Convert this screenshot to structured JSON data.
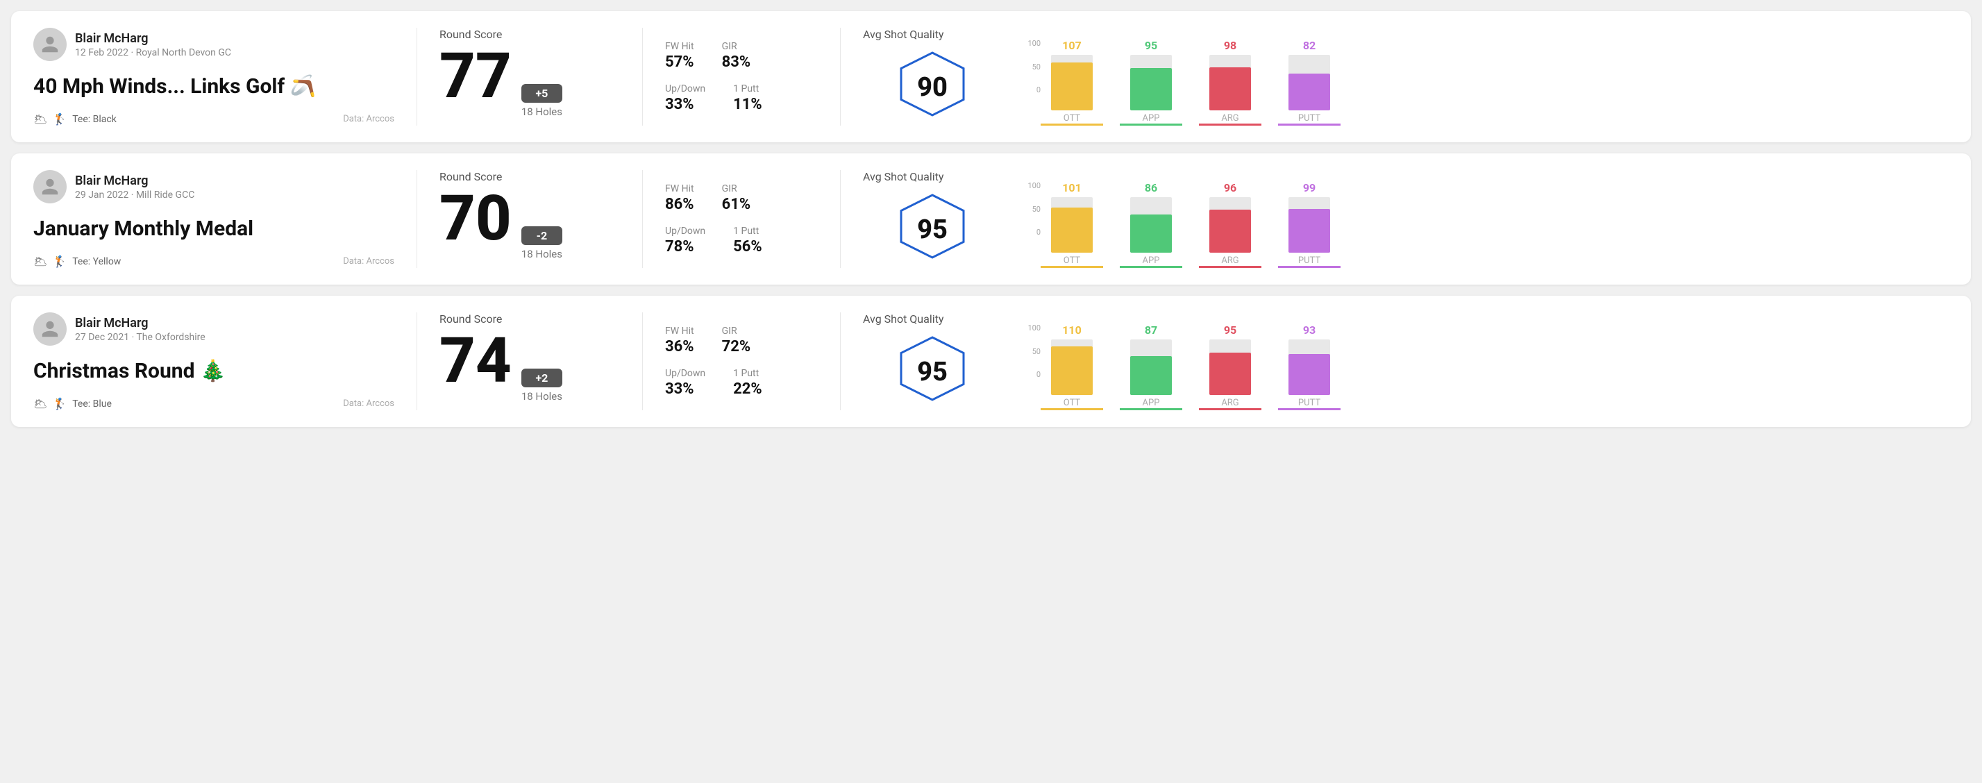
{
  "rounds": [
    {
      "id": "round-1",
      "user": {
        "name": "Blair McHarg",
        "date": "12 Feb 2022 · Royal North Devon GC"
      },
      "title": "40 Mph Winds... Links Golf 🪃",
      "tee": "Black",
      "dataSource": "Data: Arccos",
      "score": {
        "label": "Round Score",
        "value": "77",
        "modifier": "+5",
        "modifier_sign": "positive",
        "holes": "18 Holes"
      },
      "stats": {
        "fw_hit_label": "FW Hit",
        "fw_hit_value": "57%",
        "gir_label": "GIR",
        "gir_value": "83%",
        "updown_label": "Up/Down",
        "updown_value": "33%",
        "oneputt_label": "1 Putt",
        "oneputt_value": "11%"
      },
      "quality": {
        "label": "Avg Shot Quality",
        "value": "90"
      },
      "chart": {
        "bars": [
          {
            "label": "OTT",
            "value": 107,
            "max": 125,
            "color_class": "bar-ott",
            "text_class": "color-ott",
            "underline_class": "underline-ott"
          },
          {
            "label": "APP",
            "value": 95,
            "max": 125,
            "color_class": "bar-app",
            "text_class": "color-app",
            "underline_class": "underline-app"
          },
          {
            "label": "ARG",
            "value": 98,
            "max": 125,
            "color_class": "bar-arg",
            "text_class": "color-arg",
            "underline_class": "underline-arg"
          },
          {
            "label": "PUTT",
            "value": 82,
            "max": 125,
            "color_class": "bar-putt",
            "text_class": "color-putt",
            "underline_class": "underline-putt"
          }
        ],
        "y_labels": [
          "100",
          "50",
          "0"
        ]
      }
    },
    {
      "id": "round-2",
      "user": {
        "name": "Blair McHarg",
        "date": "29 Jan 2022 · Mill Ride GCC"
      },
      "title": "January Monthly Medal",
      "tee": "Yellow",
      "dataSource": "Data: Arccos",
      "score": {
        "label": "Round Score",
        "value": "70",
        "modifier": "-2",
        "modifier_sign": "negative",
        "holes": "18 Holes"
      },
      "stats": {
        "fw_hit_label": "FW Hit",
        "fw_hit_value": "86%",
        "gir_label": "GIR",
        "gir_value": "61%",
        "updown_label": "Up/Down",
        "updown_value": "78%",
        "oneputt_label": "1 Putt",
        "oneputt_value": "56%"
      },
      "quality": {
        "label": "Avg Shot Quality",
        "value": "95"
      },
      "chart": {
        "bars": [
          {
            "label": "OTT",
            "value": 101,
            "max": 125,
            "color_class": "bar-ott",
            "text_class": "color-ott",
            "underline_class": "underline-ott"
          },
          {
            "label": "APP",
            "value": 86,
            "max": 125,
            "color_class": "bar-app",
            "text_class": "color-app",
            "underline_class": "underline-app"
          },
          {
            "label": "ARG",
            "value": 96,
            "max": 125,
            "color_class": "bar-arg",
            "text_class": "color-arg",
            "underline_class": "underline-arg"
          },
          {
            "label": "PUTT",
            "value": 99,
            "max": 125,
            "color_class": "bar-putt",
            "text_class": "color-putt",
            "underline_class": "underline-putt"
          }
        ],
        "y_labels": [
          "100",
          "50",
          "0"
        ]
      }
    },
    {
      "id": "round-3",
      "user": {
        "name": "Blair McHarg",
        "date": "27 Dec 2021 · The Oxfordshire"
      },
      "title": "Christmas Round 🎄",
      "tee": "Blue",
      "dataSource": "Data: Arccos",
      "score": {
        "label": "Round Score",
        "value": "74",
        "modifier": "+2",
        "modifier_sign": "positive",
        "holes": "18 Holes"
      },
      "stats": {
        "fw_hit_label": "FW Hit",
        "fw_hit_value": "36%",
        "gir_label": "GIR",
        "gir_value": "72%",
        "updown_label": "Up/Down",
        "updown_value": "33%",
        "oneputt_label": "1 Putt",
        "oneputt_value": "22%"
      },
      "quality": {
        "label": "Avg Shot Quality",
        "value": "95"
      },
      "chart": {
        "bars": [
          {
            "label": "OTT",
            "value": 110,
            "max": 125,
            "color_class": "bar-ott",
            "text_class": "color-ott",
            "underline_class": "underline-ott"
          },
          {
            "label": "APP",
            "value": 87,
            "max": 125,
            "color_class": "bar-app",
            "text_class": "color-app",
            "underline_class": "underline-app"
          },
          {
            "label": "ARG",
            "value": 95,
            "max": 125,
            "color_class": "bar-arg",
            "text_class": "color-arg",
            "underline_class": "underline-arg"
          },
          {
            "label": "PUTT",
            "value": 93,
            "max": 125,
            "color_class": "bar-putt",
            "text_class": "color-putt",
            "underline_class": "underline-putt"
          }
        ],
        "y_labels": [
          "100",
          "50",
          "0"
        ]
      }
    }
  ]
}
